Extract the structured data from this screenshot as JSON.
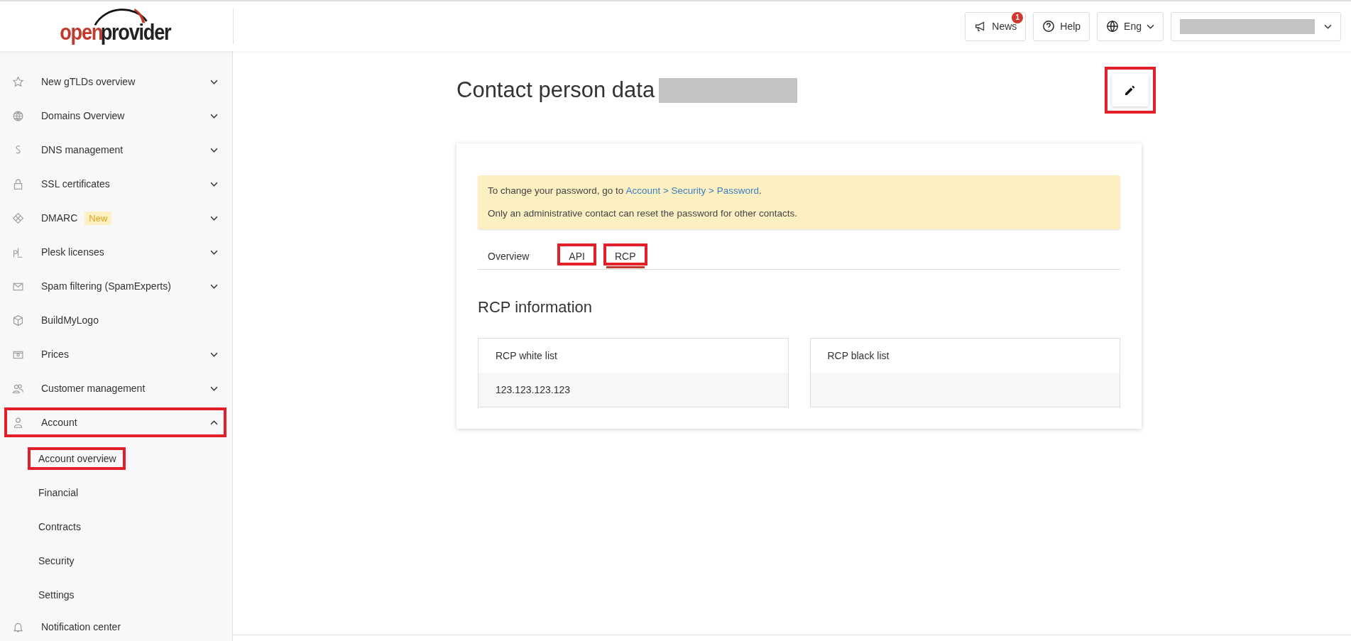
{
  "logo": {
    "words": [
      "open",
      "provider"
    ]
  },
  "header": {
    "news": {
      "label": "News",
      "count": "1"
    },
    "help": {
      "label": "Help"
    },
    "language": {
      "label": "Eng"
    },
    "user_menu": {
      "redacted": true
    }
  },
  "sidebar": {
    "items": [
      {
        "label": "New gTLDs overview",
        "expanded": false,
        "highlighted": false
      },
      {
        "label": "Domains Overview",
        "expanded": false,
        "highlighted": false
      },
      {
        "label": "DNS management",
        "expanded": false,
        "highlighted": false
      },
      {
        "label": "SSL certificates",
        "expanded": false,
        "highlighted": false
      },
      {
        "label": "DMARC",
        "badge": "New",
        "expanded": false,
        "highlighted": false
      },
      {
        "label": "Plesk licenses",
        "expanded": false,
        "highlighted": false
      },
      {
        "label": "Spam filtering (SpamExperts)",
        "expanded": false,
        "highlighted": false
      },
      {
        "label": "BuildMyLogo",
        "highlighted": false
      },
      {
        "label": "Prices",
        "expanded": false,
        "highlighted": false
      },
      {
        "label": "Customer management",
        "expanded": false,
        "highlighted": false
      },
      {
        "label": "Account",
        "expanded": true,
        "highlighted": true,
        "children": [
          {
            "label": "Account overview",
            "highlighted": true
          },
          {
            "label": "Financial",
            "highlighted": false
          },
          {
            "label": "Contracts",
            "highlighted": false
          },
          {
            "label": "Security",
            "highlighted": false
          },
          {
            "label": "Settings",
            "highlighted": false
          }
        ]
      },
      {
        "label": "Notification center",
        "highlighted": false
      }
    ]
  },
  "page": {
    "title": "Contact person data",
    "title_redacted": true,
    "edit_button": {
      "highlighted": true
    }
  },
  "notice": {
    "lines": [
      "To change your password, go to ",
      "Only an administrative contact can reset the password for other contacts."
    ],
    "link": "Account > Security > Password",
    "after_link": "."
  },
  "tabs": [
    {
      "label": "Overview",
      "selected": false,
      "highlighted": false
    },
    {
      "label": "API",
      "selected": false,
      "highlighted": true
    },
    {
      "label": "RCP",
      "selected": true,
      "highlighted": true
    }
  ],
  "section": {
    "title": "RCP information",
    "panels": [
      {
        "title": "RCP white list",
        "value": "123.123.123.123"
      },
      {
        "title": "RCP black list"
      }
    ]
  }
}
